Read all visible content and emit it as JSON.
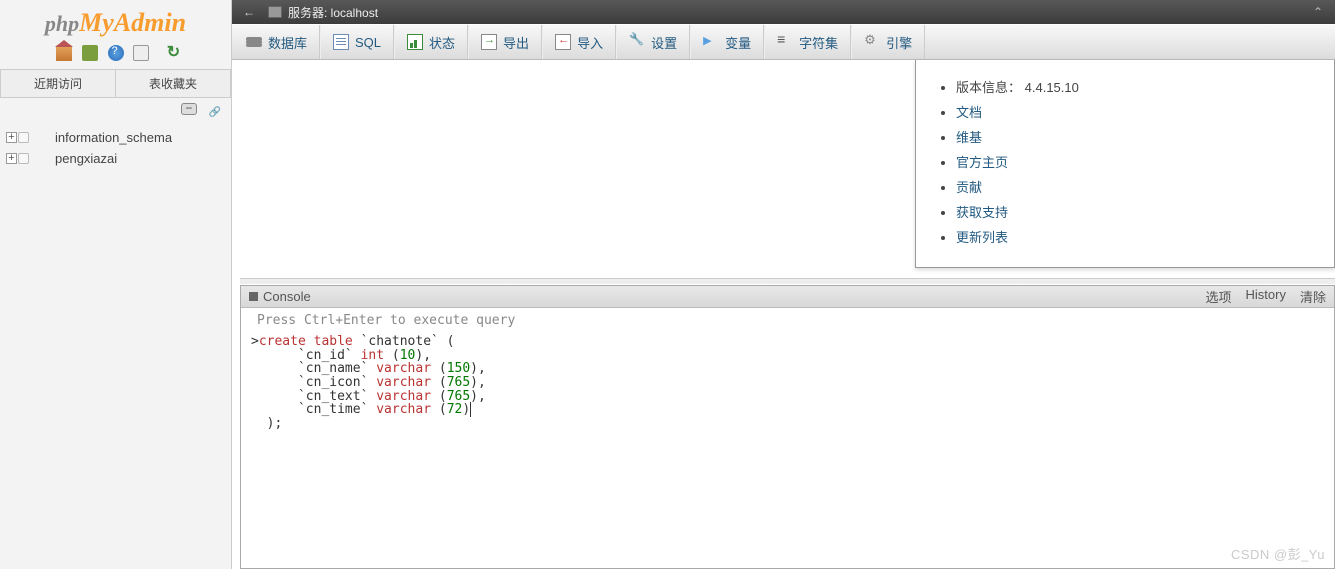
{
  "logo": {
    "part1": "php",
    "part2": "MyAdmin"
  },
  "sidebar": {
    "tabs": [
      "近期访问",
      "表收藏夹"
    ],
    "databases": [
      "information_schema",
      "pengxiazai"
    ]
  },
  "topbar": {
    "arrow": "←",
    "server_label": "服务器: localhost",
    "max": "⌃"
  },
  "toolbar": [
    {
      "name": "databases",
      "label": "数据库",
      "icon": "ico-db"
    },
    {
      "name": "sql",
      "label": "SQL",
      "icon": "ico-sql"
    },
    {
      "name": "status",
      "label": "状态",
      "icon": "ico-status"
    },
    {
      "name": "export",
      "label": "导出",
      "icon": "ico-export"
    },
    {
      "name": "import",
      "label": "导入",
      "icon": "ico-import"
    },
    {
      "name": "settings",
      "label": "设置",
      "icon": "ico-settings"
    },
    {
      "name": "variables",
      "label": "变量",
      "icon": "ico-var"
    },
    {
      "name": "charset",
      "label": "字符集",
      "icon": "ico-charset"
    },
    {
      "name": "engine",
      "label": "引擎",
      "icon": "ico-engine"
    }
  ],
  "info_panel": {
    "version_label": "版本信息：",
    "version_value": "4.4.15.10",
    "links": [
      "文档",
      "维基",
      "官方主页",
      "贡献",
      "获取支持",
      "更新列表"
    ]
  },
  "console": {
    "title": "Console",
    "actions": [
      "选项",
      "History",
      "清除"
    ],
    "hint": "Press Ctrl+Enter to execute query",
    "sql": {
      "prompt": ">",
      "line1_kw": "create table",
      "line1_tbl": " `chatnote` (",
      "fields": [
        {
          "name": "`cn_id`",
          "type": "int",
          "size": "10",
          "trail": "),"
        },
        {
          "name": "`cn_name`",
          "type": "varchar",
          "size": "150",
          "trail": "),"
        },
        {
          "name": "`cn_icon`",
          "type": "varchar",
          "size": "765",
          "trail": "),"
        },
        {
          "name": "`cn_text`",
          "type": "varchar",
          "size": "765",
          "trail": "),"
        },
        {
          "name": "`cn_time`",
          "type": "varchar",
          "size": "72",
          "trail": ")"
        }
      ],
      "close": "  );"
    }
  },
  "watermark": "CSDN @彭_Yu"
}
